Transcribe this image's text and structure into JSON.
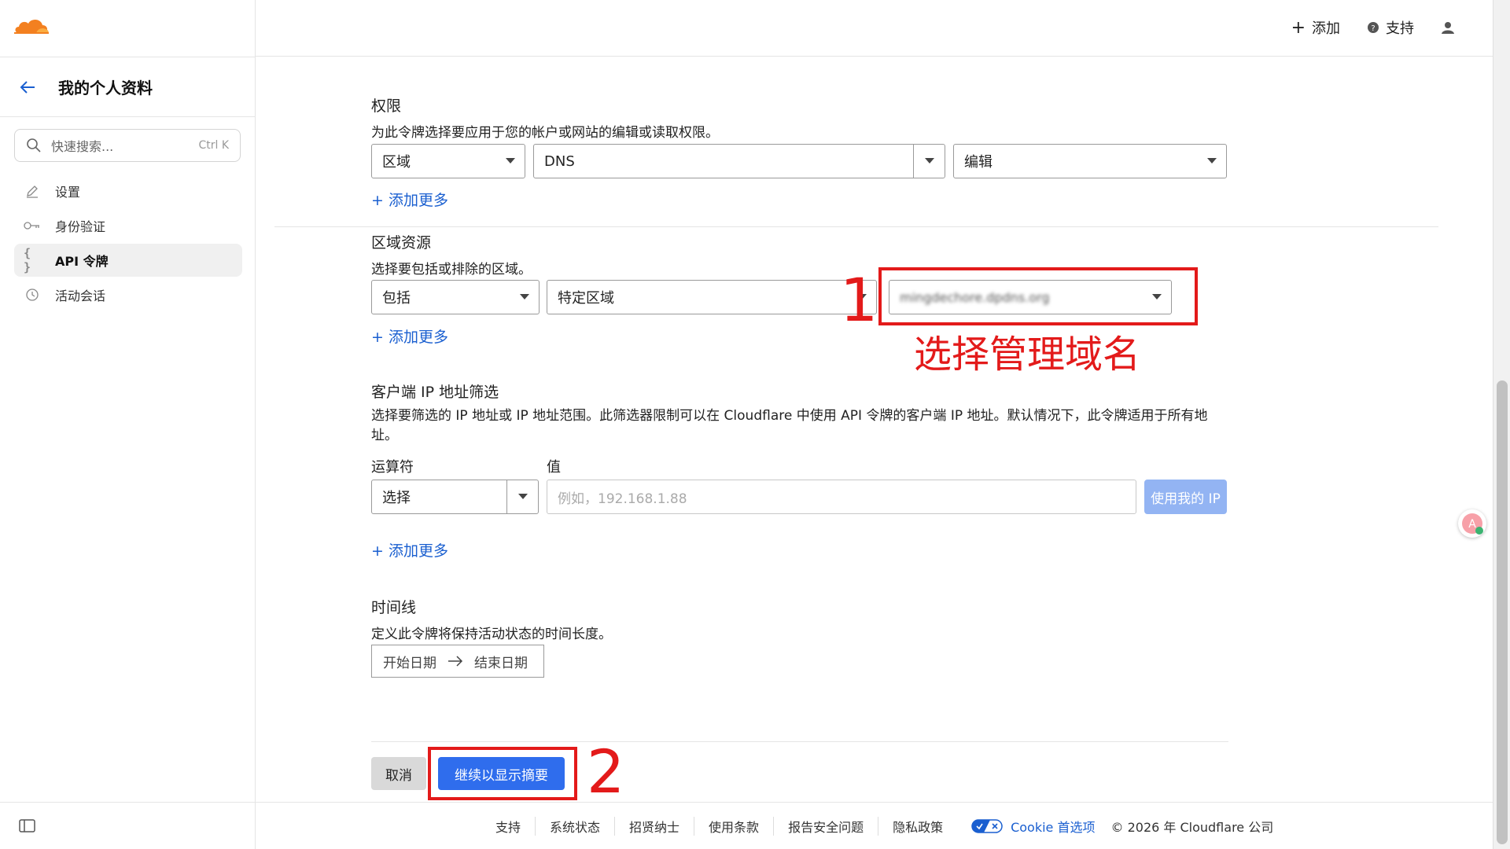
{
  "header": {
    "add_label": "添加",
    "support_label": "支持"
  },
  "sidebar": {
    "title": "我的个人资料",
    "search": {
      "placeholder": "快速搜索...",
      "shortcut": "Ctrl K"
    },
    "items": [
      {
        "label": "设置",
        "icon": "pencil-icon"
      },
      {
        "label": "身份验证",
        "icon": "key-icon"
      },
      {
        "label": "API 令牌",
        "icon": "braces-icon",
        "active": true
      },
      {
        "label": "活动会话",
        "icon": "clock-icon"
      }
    ]
  },
  "permissions": {
    "title": "权限",
    "description": "为此令牌选择要应用于您的帐户或网站的编辑或读取权限。",
    "scope": "区域",
    "resource": "DNS",
    "level": "编辑",
    "add_more": "+ 添加更多"
  },
  "zone_resources": {
    "title": "区域资源",
    "description": "选择要包括或排除的区域。",
    "include": "包括",
    "zone_type": "特定区域",
    "zone_value": "mingdechore.dpdns.org",
    "add_more": "+ 添加更多"
  },
  "ip_filter": {
    "title": "客户端 IP 地址筛选",
    "description": "选择要筛选的 IP 地址或 IP 地址范围。此筛选器限制可以在 Cloudflare 中使用 API 令牌的客户端 IP 地址。默认情况下，此令牌适用于所有地址。",
    "operator_label": "运算符",
    "value_label": "值",
    "operator_value": "选择",
    "value_placeholder": "例如，192.168.1.88",
    "use_my_ip": "使用我的 IP",
    "add_more": "+ 添加更多"
  },
  "timeline": {
    "title": "时间线",
    "description": "定义此令牌将保持活动状态的时间长度。",
    "start": "开始日期",
    "end": "结束日期"
  },
  "actions": {
    "cancel": "取消",
    "continue": "继续以显示摘要"
  },
  "annotations": {
    "step1_number": "1",
    "step1_label": "选择管理域名",
    "step2_number": "2",
    "color": "#e31a1a"
  },
  "footer": {
    "links": [
      "支持",
      "系统状态",
      "招贤纳士",
      "使用条款",
      "报告安全问题",
      "隐私政策"
    ],
    "cookie": "Cookie 首选项",
    "copyright": "© 2026 年 Cloudflare 公司"
  },
  "colors": {
    "brand_orange": "#f38020",
    "primary_blue": "#2f6ded",
    "link_blue": "#1a5fd0"
  }
}
